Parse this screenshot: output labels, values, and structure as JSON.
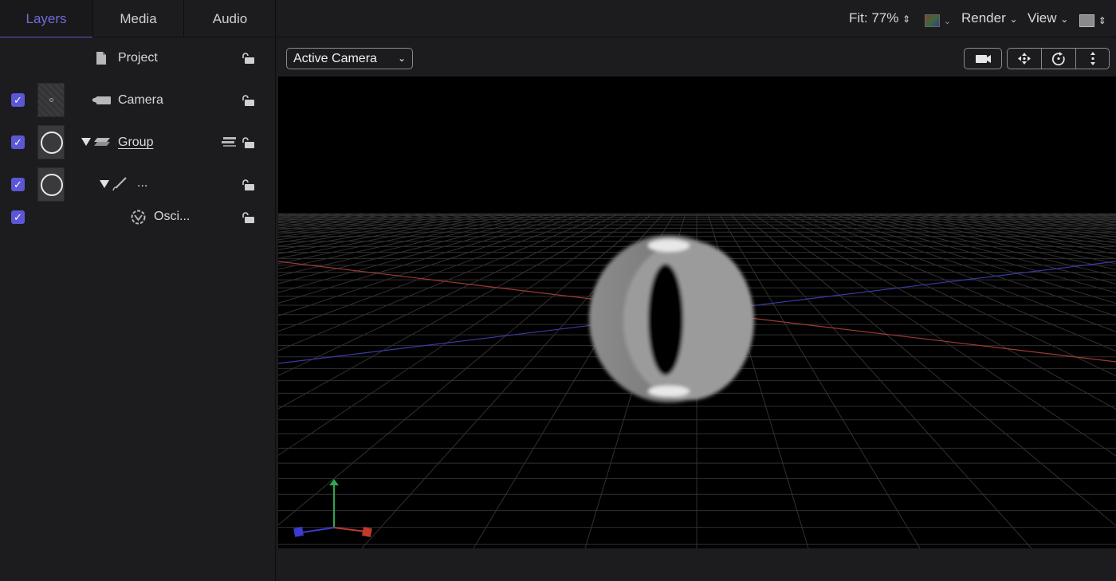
{
  "tabs": [
    {
      "label": "Layers",
      "active": true
    },
    {
      "label": "Media",
      "active": false
    },
    {
      "label": "Audio",
      "active": false
    }
  ],
  "layers": [
    {
      "name": "Project",
      "icon": "document-icon",
      "checked": null
    },
    {
      "name": "Camera",
      "icon": "camera-icon",
      "checked": true
    },
    {
      "name": "Group",
      "icon": "group-stack-icon",
      "checked": true
    },
    {
      "name": "...",
      "icon": "paint-stroke-icon",
      "checked": true
    },
    {
      "name": "Osci...",
      "icon": "behavior-gear-icon",
      "checked": true
    }
  ],
  "toolbar": {
    "fit_label": "Fit:",
    "fit_value": "77%",
    "render_label": "Render",
    "view_label": "View"
  },
  "viewer": {
    "camera_select": "Active Camera"
  },
  "colors": {
    "accent": "#5b57d6",
    "x_axis": "#c0392b",
    "y_axis": "#27ae60",
    "z_axis": "#3b3bd0"
  }
}
